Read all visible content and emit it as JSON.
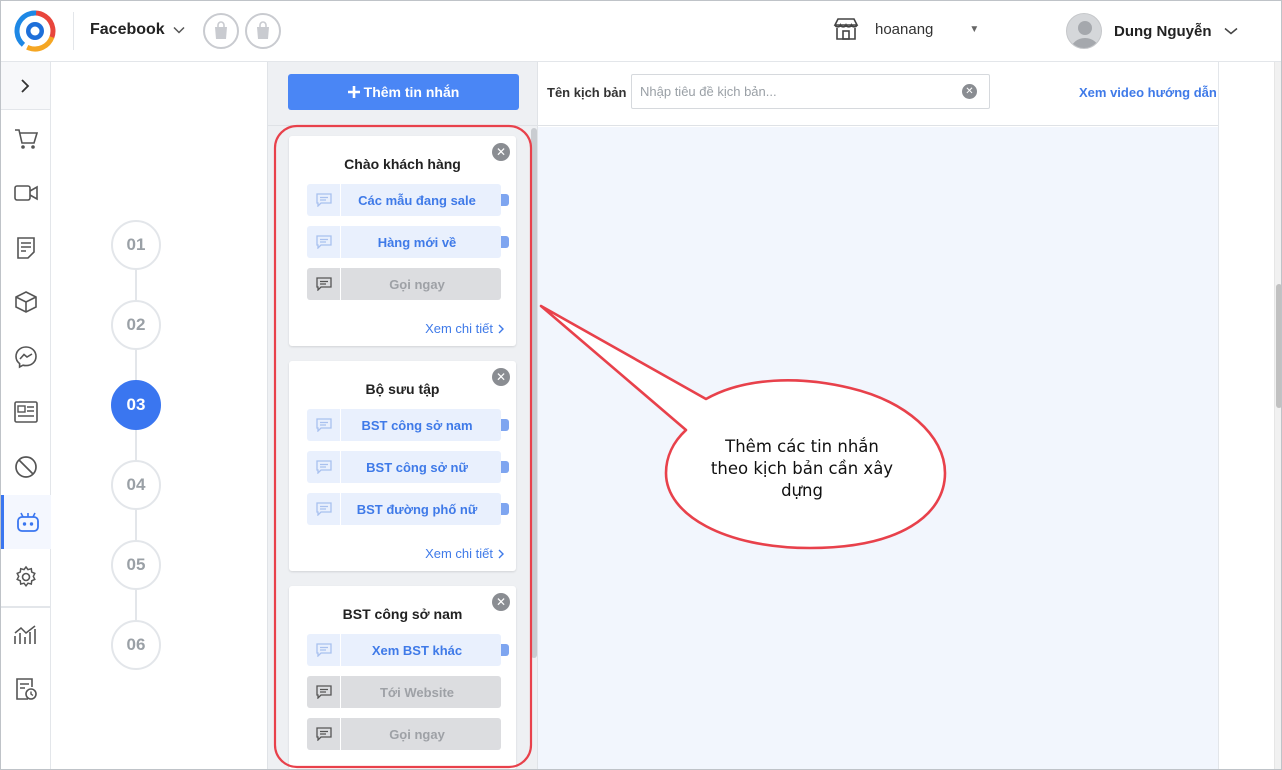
{
  "header": {
    "channel": "Facebook",
    "store_name": "hoanang",
    "user_name": "Dung Nguyễn"
  },
  "steps": [
    "01",
    "02",
    "03",
    "04",
    "05",
    "06"
  ],
  "active_step": "03",
  "message_panel": {
    "add_button": "Thêm tin nhắn",
    "cards": [
      {
        "title": "Chào khách hàng",
        "buttons": [
          {
            "label": "Các mẫu đang sale",
            "style": "blue"
          },
          {
            "label": "Hàng mới về",
            "style": "blue"
          },
          {
            "label": "Gọi ngay",
            "style": "gray"
          }
        ],
        "more": "Xem chi tiết"
      },
      {
        "title": "Bộ sưu tập",
        "buttons": [
          {
            "label": "BST công sở nam",
            "style": "blue"
          },
          {
            "label": "BST công sở nữ",
            "style": "blue"
          },
          {
            "label": "BST đường phố nữ",
            "style": "blue"
          }
        ],
        "more": "Xem chi tiết"
      },
      {
        "title": "BST công sở nam",
        "buttons": [
          {
            "label": "Xem BST khác",
            "style": "blue"
          },
          {
            "label": "Tới Website",
            "style": "gray"
          },
          {
            "label": "Gọi ngay",
            "style": "gray"
          }
        ]
      }
    ]
  },
  "scenario": {
    "label": "Tên kịch bản",
    "placeholder": "Nhập tiêu đề kịch bản...",
    "video_link": "Xem video hướng dẫn"
  },
  "annotation": {
    "lines": [
      "Thêm các tin nhắn",
      "theo kịch bản cần xây",
      "dựng"
    ]
  },
  "nav_icons": [
    "chevron-right-icon",
    "cart-icon",
    "video-icon",
    "document-icon",
    "box-icon",
    "messenger-icon",
    "id-card-icon",
    "block-icon",
    "bot-icon",
    "gear-icon",
    "chart-icon",
    "report-clock-icon"
  ],
  "colors": {
    "primary": "#4a86f5",
    "link": "#3f7ae8",
    "callout_border": "#e8414b"
  }
}
